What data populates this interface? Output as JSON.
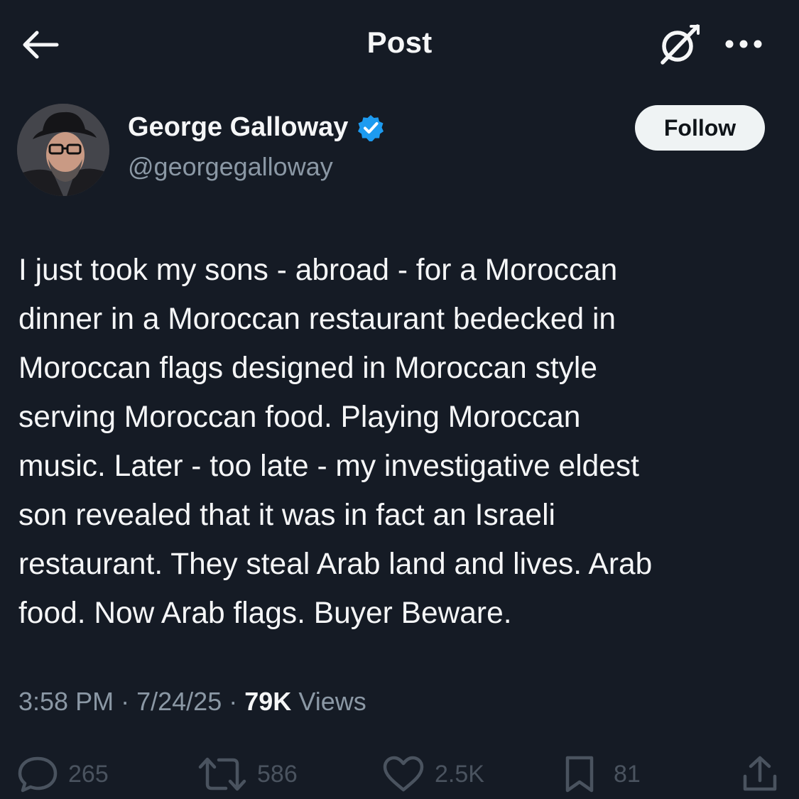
{
  "header": {
    "title": "Post",
    "back_icon": "arrow-left-icon",
    "grok_icon": "grok-icon",
    "more_icon": "more-horizontal-icon"
  },
  "author": {
    "display_name": "George Galloway",
    "handle": "@georgegalloway",
    "verified": true,
    "verified_color": "#1d9bf0",
    "follow_label": "Follow"
  },
  "tweet": {
    "lines": [
      "I just took my sons - abroad - for a Moroccan",
      "dinner in a Moroccan restaurant bedecked in",
      "Moroccan flags designed in Moroccan style",
      "serving Moroccan food. Playing Moroccan",
      "music. Later - too late - my investigative eldest",
      "son revealed that it was in fact an Israeli",
      "restaurant. They steal Arab land and lives. Arab",
      "food. Now Arab flags. Buyer Beware."
    ]
  },
  "meta": {
    "time": "3:58 PM",
    "separator": "·",
    "date": "7/24/25",
    "views_count": "79K",
    "views_label": "Views"
  },
  "actions": {
    "replies": {
      "icon": "reply-icon",
      "count": "265"
    },
    "reposts": {
      "icon": "repost-icon",
      "count": "586"
    },
    "likes": {
      "icon": "heart-icon",
      "count": "2.5K"
    },
    "bookmarks": {
      "icon": "bookmark-icon",
      "count": "81"
    },
    "share": {
      "icon": "share-icon"
    }
  },
  "colors": {
    "background": "#151b25",
    "text_primary": "#f5f6f7",
    "text_secondary": "#8b98a5",
    "follow_bg": "#eff3f4"
  }
}
